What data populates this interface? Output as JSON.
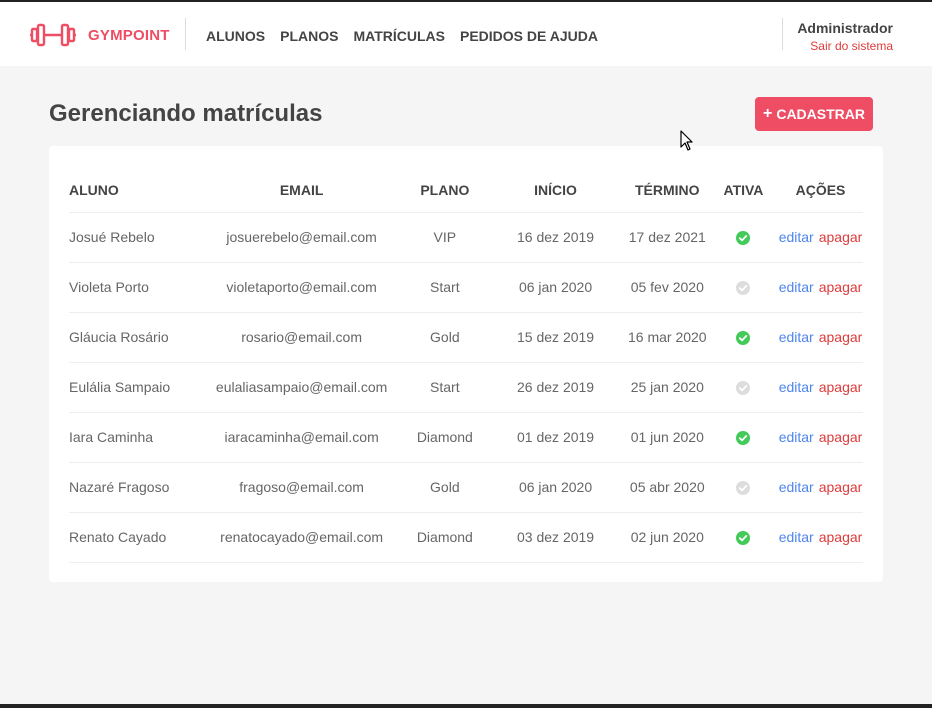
{
  "header": {
    "brand": "GYMPOINT",
    "nav": [
      "ALUNOS",
      "PLANOS",
      "MATRÍCULAS",
      "PEDIDOS DE AJUDA"
    ],
    "user_name": "Administrador",
    "logout_label": "Sair do sistema"
  },
  "main": {
    "title": "Gerenciando matrículas",
    "add_label": "CADASTRAR"
  },
  "table": {
    "headers": [
      "ALUNO",
      "EMAIL",
      "PLANO",
      "INÍCIO",
      "TÉRMINO",
      "ATIVA",
      "AÇÕES"
    ],
    "edit_label": "editar",
    "delete_label": "apagar",
    "rows": [
      {
        "aluno": "Josué Rebelo",
        "email": "josuerebelo@email.com",
        "plano": "VIP",
        "inicio": "16 dez 2019",
        "termino": "17 dez 2021",
        "ativa": true
      },
      {
        "aluno": "Violeta Porto",
        "email": "violetaporto@email.com",
        "plano": "Start",
        "inicio": "06 jan 2020",
        "termino": "05 fev 2020",
        "ativa": false
      },
      {
        "aluno": "Gláucia Rosário",
        "email": "rosario@email.com",
        "plano": "Gold",
        "inicio": "15 dez 2019",
        "termino": "16 mar 2020",
        "ativa": true
      },
      {
        "aluno": "Eulália Sampaio",
        "email": "eulaliasampaio@email.com",
        "plano": "Start",
        "inicio": "26 dez 2019",
        "termino": "25 jan 2020",
        "ativa": false
      },
      {
        "aluno": "Iara Caminha",
        "email": "iaracaminha@email.com",
        "plano": "Diamond",
        "inicio": "01 dez 2019",
        "termino": "01 jun 2020",
        "ativa": true
      },
      {
        "aluno": "Nazaré Fragoso",
        "email": "fragoso@email.com",
        "plano": "Gold",
        "inicio": "06 jan 2020",
        "termino": "05 abr 2020",
        "ativa": false
      },
      {
        "aluno": "Renato Cayado",
        "email": "renatocayado@email.com",
        "plano": "Diamond",
        "inicio": "03 dez 2019",
        "termino": "02 jun 2020",
        "ativa": true
      }
    ]
  },
  "colors": {
    "accent": "#ee4d64",
    "active_check": "#42cb59",
    "inactive_check": "#dddddd",
    "edit_link": "#4d85ee",
    "delete_link": "#de3b3b"
  }
}
